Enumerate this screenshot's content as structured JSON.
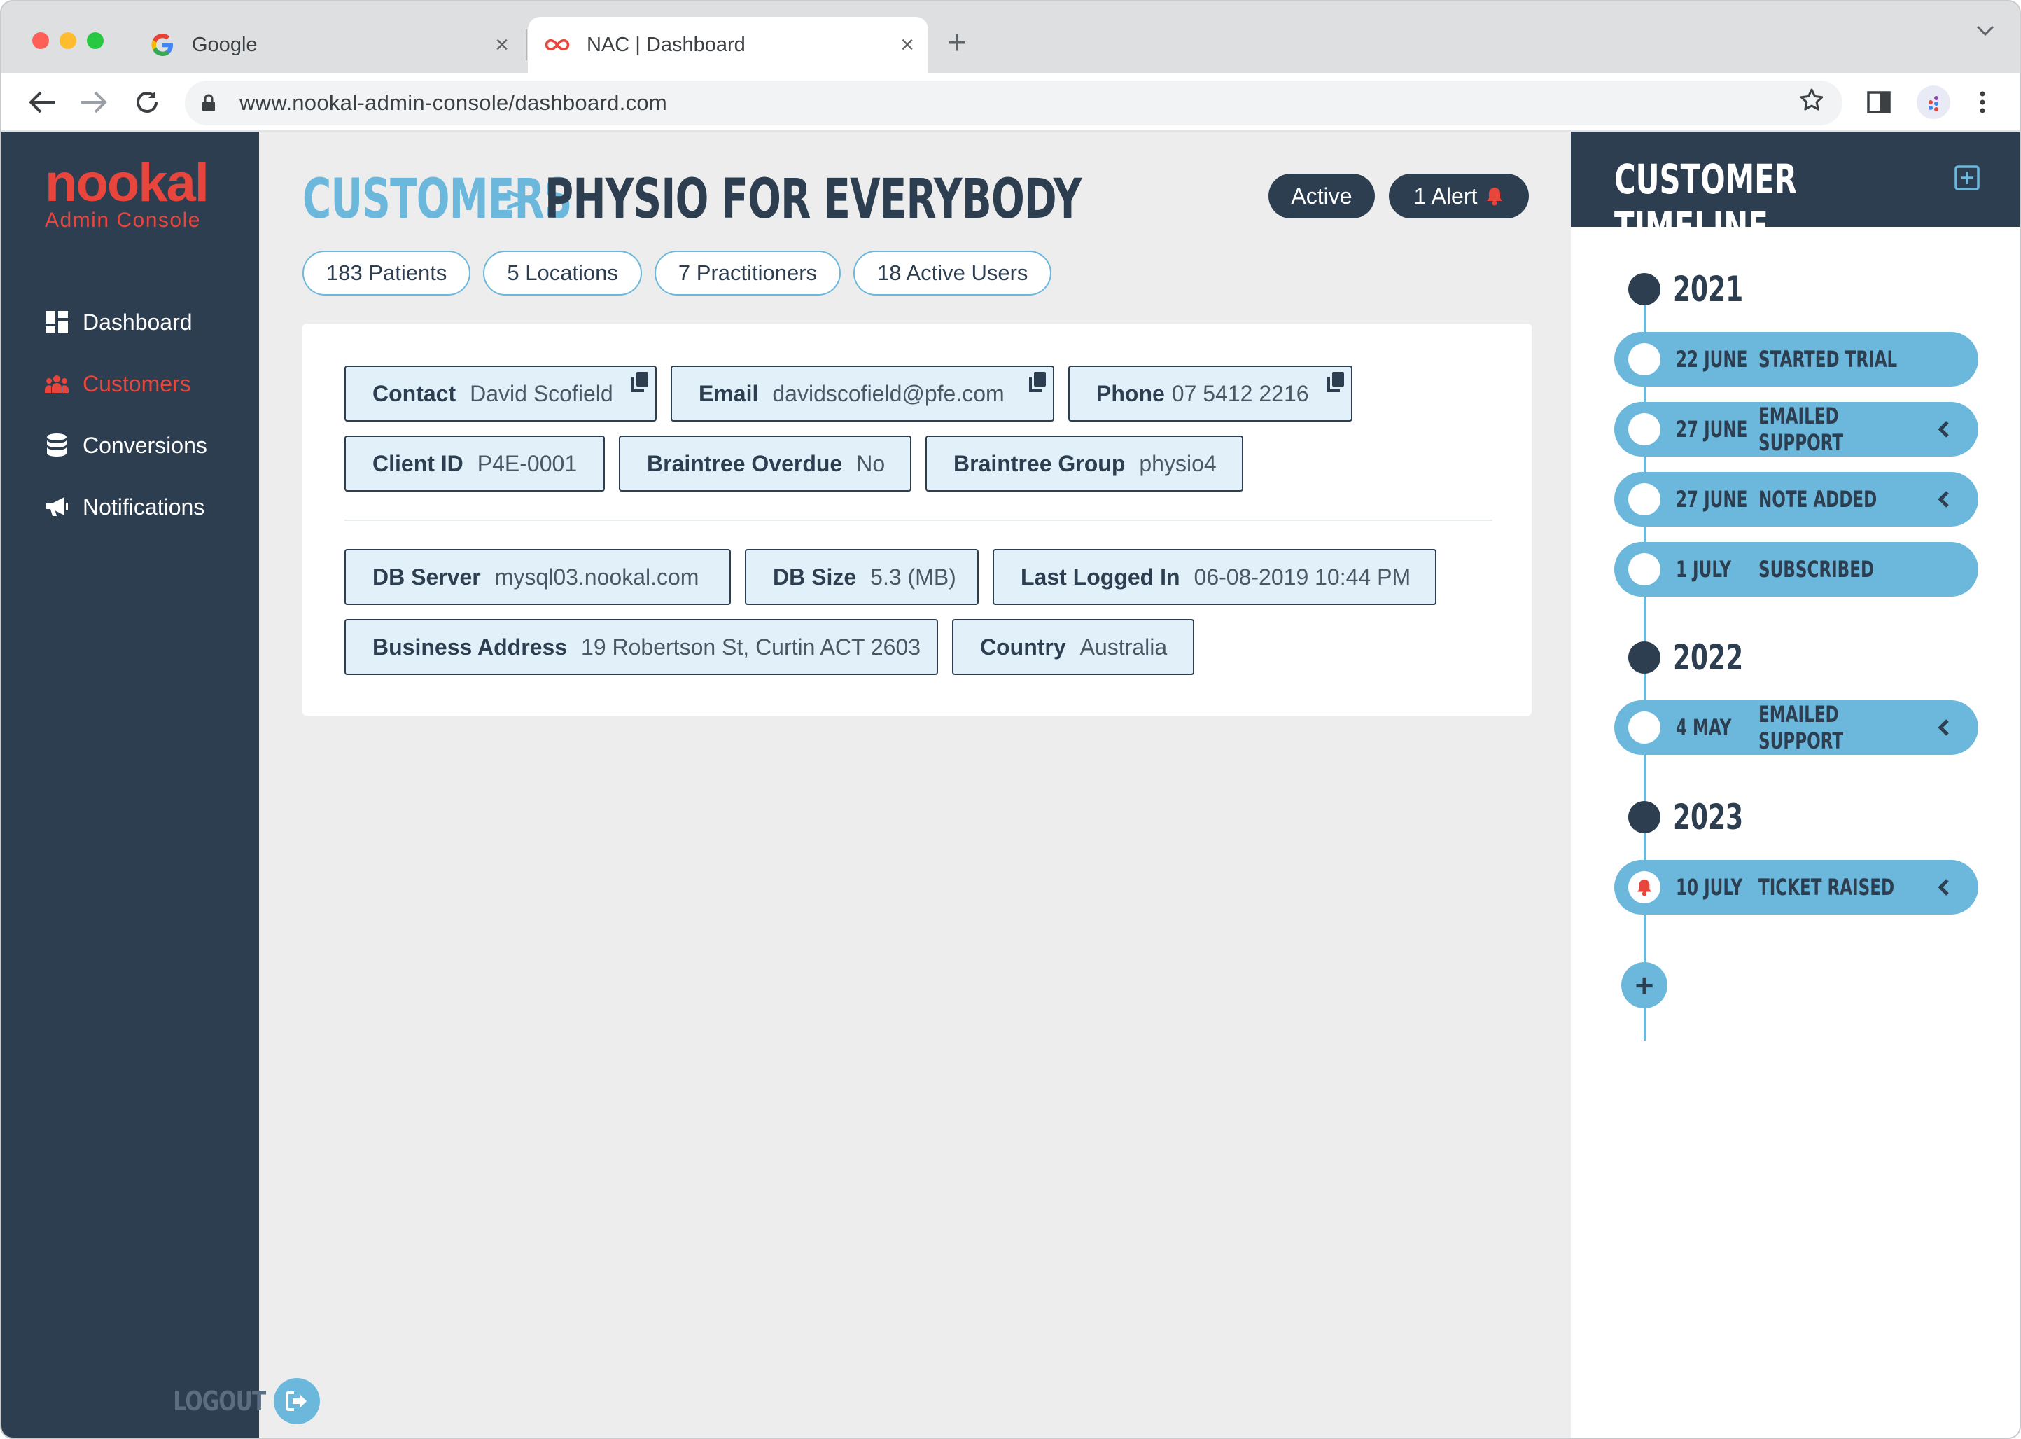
{
  "browser": {
    "tabs": [
      {
        "title": "Google",
        "icon": "google-g-icon",
        "active": false
      },
      {
        "title": "NAC | Dashboard",
        "icon": "nookal-infinity-icon",
        "active": true
      }
    ],
    "url": "www.nookal-admin-console/dashboard.com",
    "new_tab_symbol": "+",
    "close_symbol": "×"
  },
  "sidebar": {
    "logo_word": "nookal",
    "logo_subtitle": "Admin Console",
    "items": [
      {
        "label": "Dashboard",
        "icon": "grid-dashboard-icon",
        "active": false
      },
      {
        "label": "Customers",
        "icon": "users-group-icon",
        "active": true
      },
      {
        "label": "Conversions",
        "icon": "database-icon",
        "active": false
      },
      {
        "label": "Notifications",
        "icon": "megaphone-icon",
        "active": false
      }
    ],
    "logout_label": "LOGOUT",
    "accent_color": "#e8453c",
    "background_color": "#2d3e50"
  },
  "header": {
    "breadcrumb_parent": "CUSTOMERS",
    "breadcrumb_separator": ">",
    "breadcrumb_current": "PHYSIO FOR EVERYBODY",
    "status_label": "Active",
    "alert_label": "1 Alert",
    "stats": [
      "183 Patients",
      "5 Locations",
      "7 Practitioners",
      "18 Active Users"
    ]
  },
  "details": {
    "contact": {
      "label": "Contact",
      "value": "David Scofield"
    },
    "email": {
      "label": "Email",
      "value": "davidscofield@pfe.com"
    },
    "phone": {
      "label": "Phone",
      "value": "07 5412 2216"
    },
    "client_id": {
      "label": "Client ID",
      "value": "P4E-0001"
    },
    "braintree_overdue": {
      "label": "Braintree Overdue",
      "value": "No"
    },
    "braintree_group": {
      "label": "Braintree Group",
      "value": "physio4"
    },
    "db_server": {
      "label": "DB Server",
      "value": "mysql03.nookal.com"
    },
    "db_size": {
      "label": "DB Size",
      "value": "5.3 (MB)"
    },
    "last_logged_in": {
      "label": "Last Logged In",
      "value": "06-08-2019 10:44 PM"
    },
    "business_address": {
      "label": "Business Address",
      "value": "19 Robertson St, Curtin ACT 2603"
    },
    "country": {
      "label": "Country",
      "value": "Australia"
    }
  },
  "timeline": {
    "title": "CUSTOMER TIMELINE",
    "years": [
      {
        "year": "2021",
        "events": [
          {
            "date": "22 JUNE",
            "text": "STARTED TRIAL",
            "expandable": false
          },
          {
            "date": "27 JUNE",
            "text": "EMAILED SUPPORT",
            "expandable": true
          },
          {
            "date": "27 JUNE",
            "text": "NOTE ADDED",
            "expandable": true
          },
          {
            "date": "1 JULY",
            "text": "SUBSCRIBED",
            "expandable": false
          }
        ]
      },
      {
        "year": "2022",
        "events": [
          {
            "date": "4 MAY",
            "text": "EMAILED SUPPORT",
            "expandable": true
          }
        ]
      },
      {
        "year": "2023",
        "events": [
          {
            "date": "10 JULY",
            "text": "TICKET RAISED",
            "expandable": true,
            "alert": true
          }
        ]
      }
    ],
    "add_symbol": "+",
    "accent_color": "#6bb8dc"
  }
}
